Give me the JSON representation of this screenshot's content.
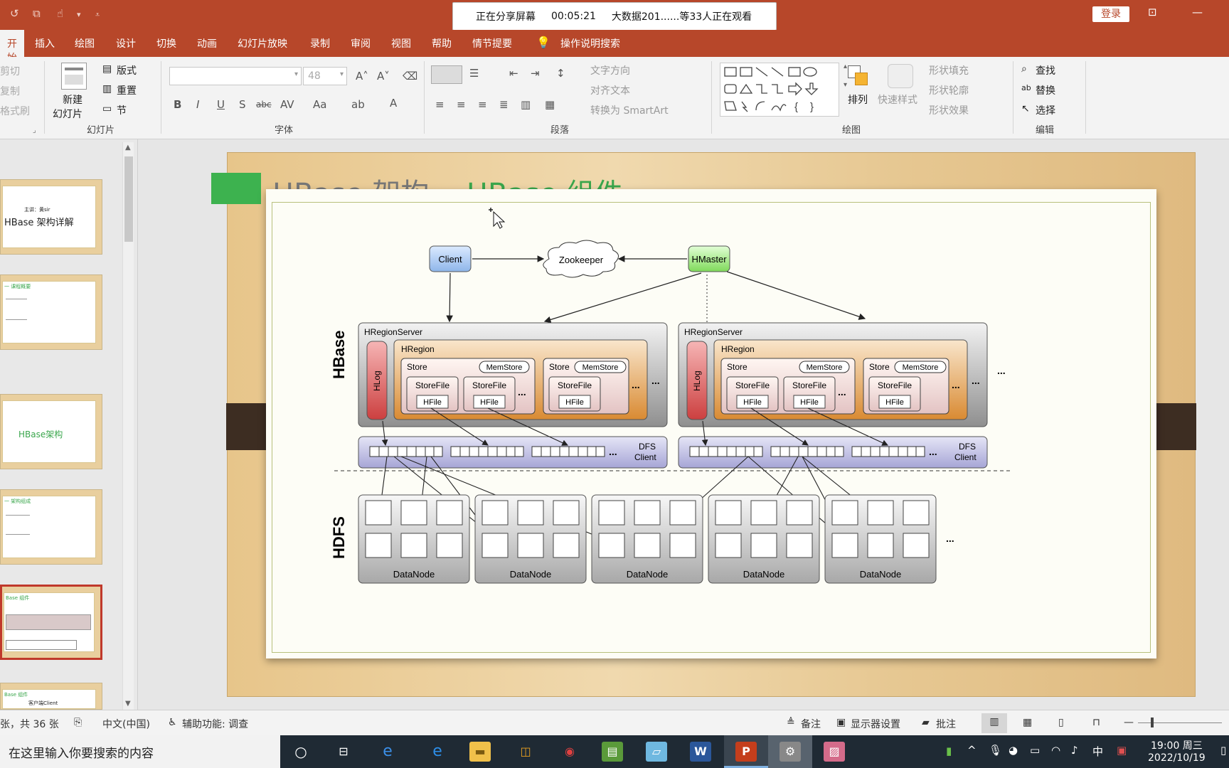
{
  "titlebar": {
    "share_status": "正在分享屏幕",
    "share_time": "00:05:21",
    "viewers": "大数据201......等33人正在观看",
    "login": "登录"
  },
  "menu": {
    "tabs": [
      "开始",
      "插入",
      "绘图",
      "设计",
      "切换",
      "动画",
      "幻灯片放映",
      "录制",
      "审阅",
      "视图",
      "帮助",
      "情节提要"
    ],
    "tell_me": "操作说明搜索"
  },
  "ribbon": {
    "clipboard": {
      "cut": "剪切",
      "copy": "复制",
      "painter": "格式刷"
    },
    "slides": {
      "new_slide_1": "新建",
      "new_slide_2": "幻灯片",
      "layout": "版式",
      "reset": "重置",
      "section": "节",
      "label": "幻灯片"
    },
    "font": {
      "size": "48",
      "label": "字体",
      "bold": "B",
      "italic": "I",
      "underline": "U",
      "shadow": "S",
      "strike": "abc",
      "spacing": "AV",
      "case": "Aa",
      "color": "A"
    },
    "paragraph": {
      "text_direction": "文字方向",
      "align_text": "对齐文本",
      "smartart": "转换为 SmartArt",
      "label": "段落"
    },
    "drawing": {
      "arrange": "排列",
      "quick_styles": "快速样式",
      "fill": "形状填充",
      "outline": "形状轮廓",
      "effects": "形状效果",
      "label": "绘图"
    },
    "editing": {
      "find": "查找",
      "replace": "替换",
      "select": "选择",
      "label": "编辑"
    }
  },
  "thumbnails": [
    {
      "line1": "主讲：黄sir",
      "line2": "HBase 架构详解"
    },
    {
      "line1": "一 课程概要",
      "line2": ""
    },
    {
      "line1": "",
      "line2": "HBase架构"
    },
    {
      "line1": "一 架构组成",
      "line2": ""
    },
    {
      "line1": "Base 组件",
      "line2": ""
    },
    {
      "line1": "Base 组件",
      "line2": "客户端Client"
    }
  ],
  "slide": {
    "title_part1": "HBase 架构— ",
    "title_part2": "HBase 组件"
  },
  "diagram": {
    "client": "Client",
    "zookeeper": "Zookeeper",
    "hmaster": "HMaster",
    "hbase_label": "HBase",
    "hdfs_label": "HDFS",
    "region_server": "HRegionServer",
    "hregion": "HRegion",
    "hlog": "HLog",
    "store": "Store",
    "memstore": "MemStore",
    "storefile": "StoreFile",
    "hfile": "HFile",
    "dfs_client_1": "DFS",
    "dfs_client_2": "Client",
    "datanode": "DataNode",
    "ellipsis": "..."
  },
  "status": {
    "slide_count": "张，共 36 张",
    "language": "中文(中国)",
    "accessibility": "辅助功能: 调查",
    "notes": "备注",
    "display": "显示器设置",
    "comments": "批注"
  },
  "taskbar": {
    "search_placeholder": "在这里输入你要搜索的内容",
    "ime": "中",
    "time": "19:00 周三",
    "date": "2022/10/19"
  },
  "colors": {
    "accent": "#b7472a",
    "title_green": "#3aa64c",
    "hlog": "#d9534f",
    "hregion": "#e2a04a",
    "dfs": "#b9b8e0",
    "hmaster": "#a8e98a",
    "client": "#a7c9f2"
  }
}
